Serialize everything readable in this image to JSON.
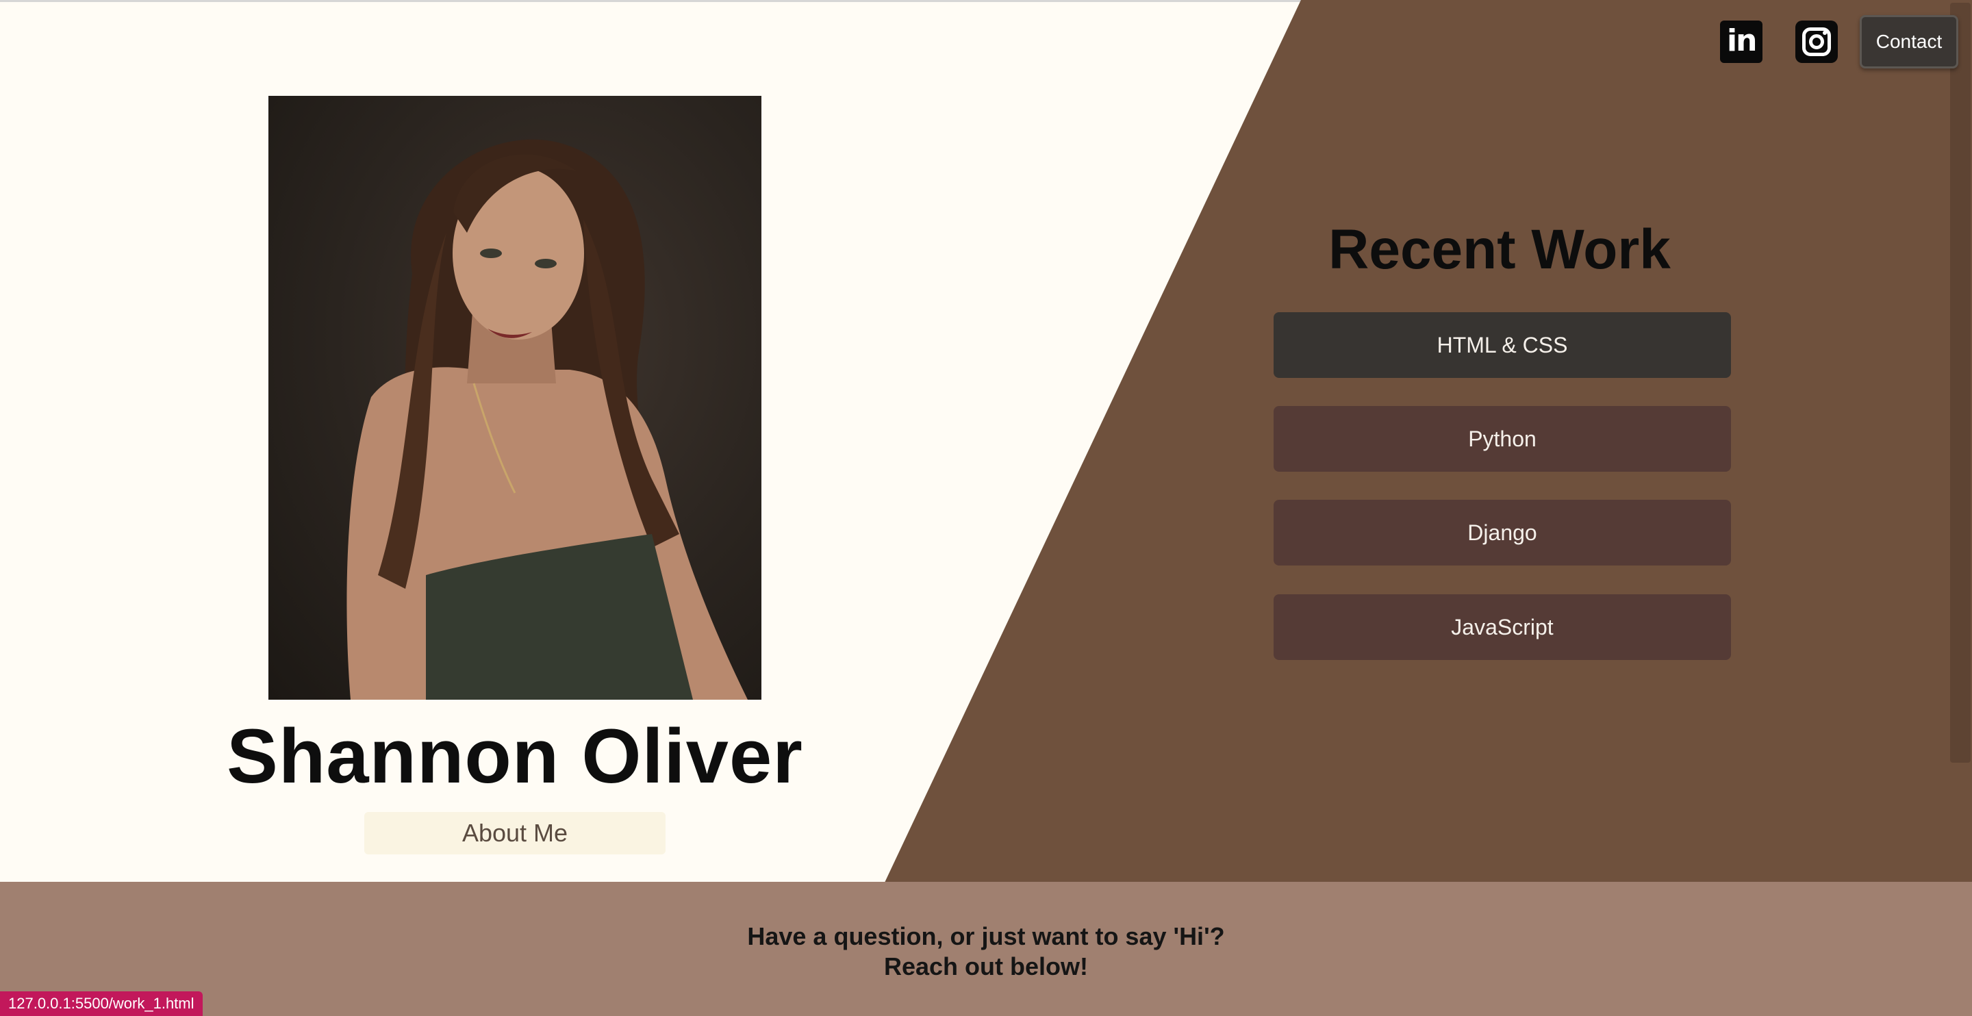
{
  "header": {
    "linkedin_icon": "linkedin-icon",
    "instagram_icon": "instagram-icon",
    "contact_label": "Contact"
  },
  "hero": {
    "name": "Shannon Oliver",
    "about_label": "About Me"
  },
  "recent_work": {
    "title": "Recent Work",
    "items": [
      {
        "label": "HTML & CSS"
      },
      {
        "label": "Python"
      },
      {
        "label": "Django"
      },
      {
        "label": "JavaScript"
      }
    ]
  },
  "footer": {
    "line1": "Have a question, or just want to say 'Hi'?",
    "line2": "Reach out below!"
  },
  "status_bar": {
    "url": "127.0.0.1:5500/work_1.html"
  },
  "colors": {
    "background": "#fffcf5",
    "brown_panel": "#6f513d",
    "active_button": "#373431",
    "inactive_button": "#553b36",
    "footer": "#a08070",
    "status_url": "#c2185b"
  }
}
